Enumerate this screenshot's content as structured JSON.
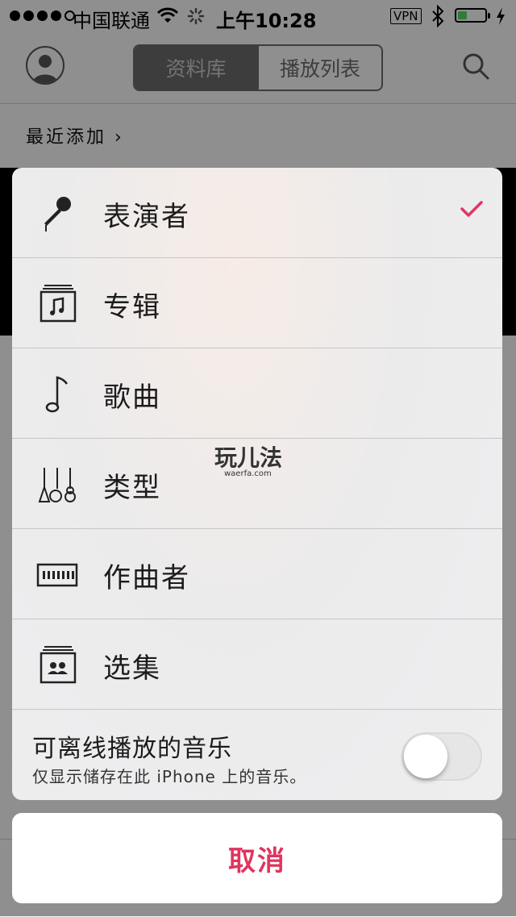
{
  "status": {
    "carrier": "中国联通",
    "time": "上午10:28",
    "vpn": "VPN",
    "battery_level": 0.35
  },
  "nav": {
    "seg_library": "资料库",
    "seg_playlists": "播放列表"
  },
  "recent_label": "最近添加",
  "sheet": {
    "options": [
      {
        "label": "表演者",
        "icon": "microphone-icon",
        "selected": true
      },
      {
        "label": "专辑",
        "icon": "album-icon",
        "selected": false
      },
      {
        "label": "歌曲",
        "icon": "music-note-icon",
        "selected": false
      },
      {
        "label": "类型",
        "icon": "guitars-icon",
        "selected": false
      },
      {
        "label": "作曲者",
        "icon": "piano-icon",
        "selected": false
      },
      {
        "label": "选集",
        "icon": "compilation-icon",
        "selected": false
      }
    ],
    "offline_title": "可离线播放的音乐",
    "offline_subtitle": "仅显示储存在此 iPhone 上的音乐。",
    "offline_enabled": false
  },
  "watermark": {
    "text": "玩儿法",
    "sub": "waerfa.com"
  },
  "cancel_label": "取消",
  "colors": {
    "accent": "#e0355e",
    "separator": "#c6c6c8"
  }
}
